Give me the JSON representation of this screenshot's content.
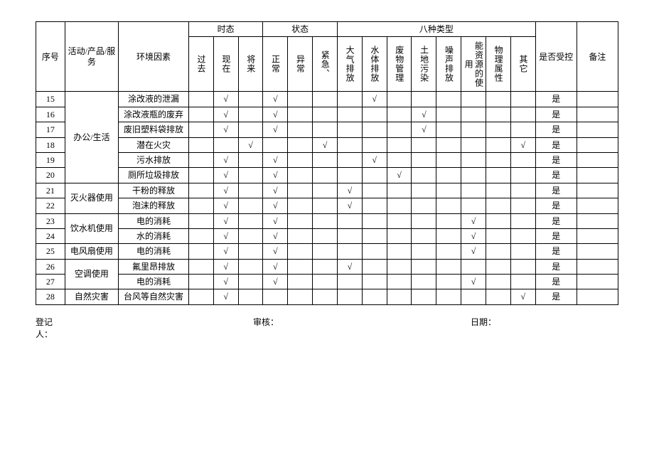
{
  "headers": {
    "seq": "序号",
    "activity": "活动/产品/服务",
    "env_factor": "环境因素",
    "tense_group": "时态",
    "state_group": "状态",
    "type_group": "八种类型",
    "controlled": "是否受控",
    "remark": "备注",
    "tense": {
      "past": "过去",
      "present": "现在",
      "future": "将来"
    },
    "state": {
      "normal": "正常",
      "abnormal": "异常",
      "emergency": "紧急、"
    },
    "type": {
      "air": "大气排放",
      "water": "水体排放",
      "waste": "废物管理",
      "land": "土地污染",
      "noise": "噪声排放",
      "energy": "能资源的使用",
      "physical": "物理属性",
      "other": "其它"
    }
  },
  "groups": [
    {
      "name": "办公/生活",
      "rows": [
        {
          "seq": "15",
          "env": "涂改液的泄漏",
          "marks": {
            "present": "√",
            "normal": "√",
            "water": "√"
          },
          "ctrl": "是"
        },
        {
          "seq": "16",
          "env": "涂改液瓶的废弃",
          "marks": {
            "present": "√",
            "normal": "√",
            "land": "√"
          },
          "ctrl": "是"
        },
        {
          "seq": "17",
          "env": "废旧塑料袋排放",
          "marks": {
            "present": "√",
            "normal": "√",
            "land": "√"
          },
          "ctrl": "是"
        },
        {
          "seq": "18",
          "env": "潜在火灾",
          "marks": {
            "future": "√",
            "emergency": "√",
            "other": "√"
          },
          "ctrl": "是"
        },
        {
          "seq": "19",
          "env": "污水排放",
          "marks": {
            "present": "√",
            "normal": "√",
            "water": "√"
          },
          "ctrl": "是"
        },
        {
          "seq": "20",
          "env": "厕所垃圾排放",
          "marks": {
            "present": "√",
            "normal": "√",
            "waste": "√"
          },
          "ctrl": "是"
        }
      ]
    },
    {
      "name": "灭火器使用",
      "rows": [
        {
          "seq": "21",
          "env": "干粉的释放",
          "marks": {
            "present": "√",
            "normal": "√",
            "air": "√"
          },
          "ctrl": "是"
        },
        {
          "seq": "22",
          "env": "泡沫的释放",
          "marks": {
            "present": "√",
            "normal": "√",
            "air": "√"
          },
          "ctrl": "是"
        }
      ]
    },
    {
      "name": "饮水机使用",
      "rows": [
        {
          "seq": "23",
          "env": "电的消耗",
          "marks": {
            "present": "√",
            "normal": "√",
            "energy": "√"
          },
          "ctrl": "是"
        },
        {
          "seq": "24",
          "env": "水的消耗",
          "marks": {
            "present": "√",
            "normal": "√",
            "energy": "√"
          },
          "ctrl": "是"
        }
      ]
    },
    {
      "name": "电风扇使用",
      "rows": [
        {
          "seq": "25",
          "env": "电的消耗",
          "marks": {
            "present": "√",
            "normal": "√",
            "energy": "√"
          },
          "ctrl": "是"
        }
      ]
    },
    {
      "name": "空调使用",
      "rows": [
        {
          "seq": "26",
          "env": "氟里昂排放",
          "marks": {
            "present": "√",
            "normal": "√",
            "air": "√"
          },
          "ctrl": "是"
        },
        {
          "seq": "27",
          "env": "电的消耗",
          "marks": {
            "present": "√",
            "normal": "√",
            "energy": "√"
          },
          "ctrl": "是"
        }
      ]
    },
    {
      "name": "自然灾害",
      "rows": [
        {
          "seq": "28",
          "env": "台风等自然灾害",
          "marks": {
            "present": "√",
            "other": "√"
          },
          "ctrl": "是"
        }
      ]
    }
  ],
  "footer": {
    "registrant": "登记人：",
    "auditor": "审核：",
    "date": "日期："
  },
  "mark_cols": [
    "past",
    "present",
    "future",
    "normal",
    "abnormal",
    "emergency",
    "air",
    "water",
    "waste",
    "land",
    "noise",
    "energy",
    "physical",
    "other"
  ]
}
